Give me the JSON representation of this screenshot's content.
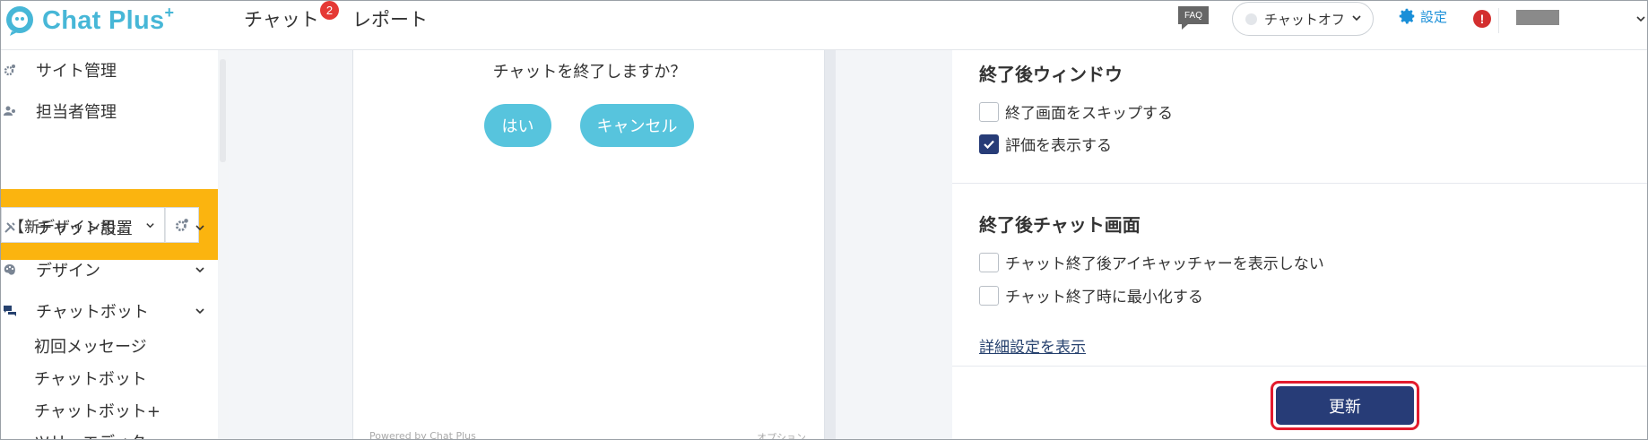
{
  "header": {
    "logo_text": "Chat Plus",
    "logo_plus": "+",
    "nav": [
      {
        "label": "チャット",
        "badge": "2"
      },
      {
        "label": "レポート"
      }
    ],
    "faq_label": "FAQ",
    "status_label": "チャットオフ",
    "settings_label": "設定",
    "alert_label": "!"
  },
  "sidebar": {
    "items": [
      {
        "label": "サイト管理",
        "icon": "gears-icon"
      },
      {
        "label": "担当者管理",
        "icon": "users-icon"
      }
    ],
    "site_select_value": "【新デザイン用…",
    "groups": [
      {
        "label": "チャット設置",
        "icon": "tools-icon"
      },
      {
        "label": "デザイン",
        "icon": "palette-icon"
      },
      {
        "label": "チャットボット",
        "icon": "chat-bubbles-icon"
      }
    ],
    "sub_items": [
      "初回メッセージ",
      "チャットボット",
      "チャットボット+",
      "ツリーエディタ"
    ]
  },
  "preview": {
    "question": "チャットを終了しますか？",
    "yes_label": "はい",
    "cancel_label": "キャンセル",
    "powered_by": "Powered by Chat Plus",
    "option_label": "オプション"
  },
  "panel": {
    "section1_title": "終了後ウィンドウ",
    "section1_options": [
      {
        "label": "終了画面をスキップする",
        "checked": false
      },
      {
        "label": "評価を表示する",
        "checked": true
      }
    ],
    "section2_title": "終了後チャット画面",
    "section2_options": [
      {
        "label": "チャット終了後アイキャッチャーを表示しない",
        "checked": false
      },
      {
        "label": "チャット終了時に最小化する",
        "checked": false
      }
    ],
    "detail_link": "詳細設定を表示",
    "update_label": "更新"
  },
  "colors": {
    "brand": "#47b7d7",
    "accent_orange": "#fbb40f",
    "primary_navy": "#273c77",
    "pill_cyan": "#57c4dd",
    "highlight_red": "#e21b2d"
  }
}
